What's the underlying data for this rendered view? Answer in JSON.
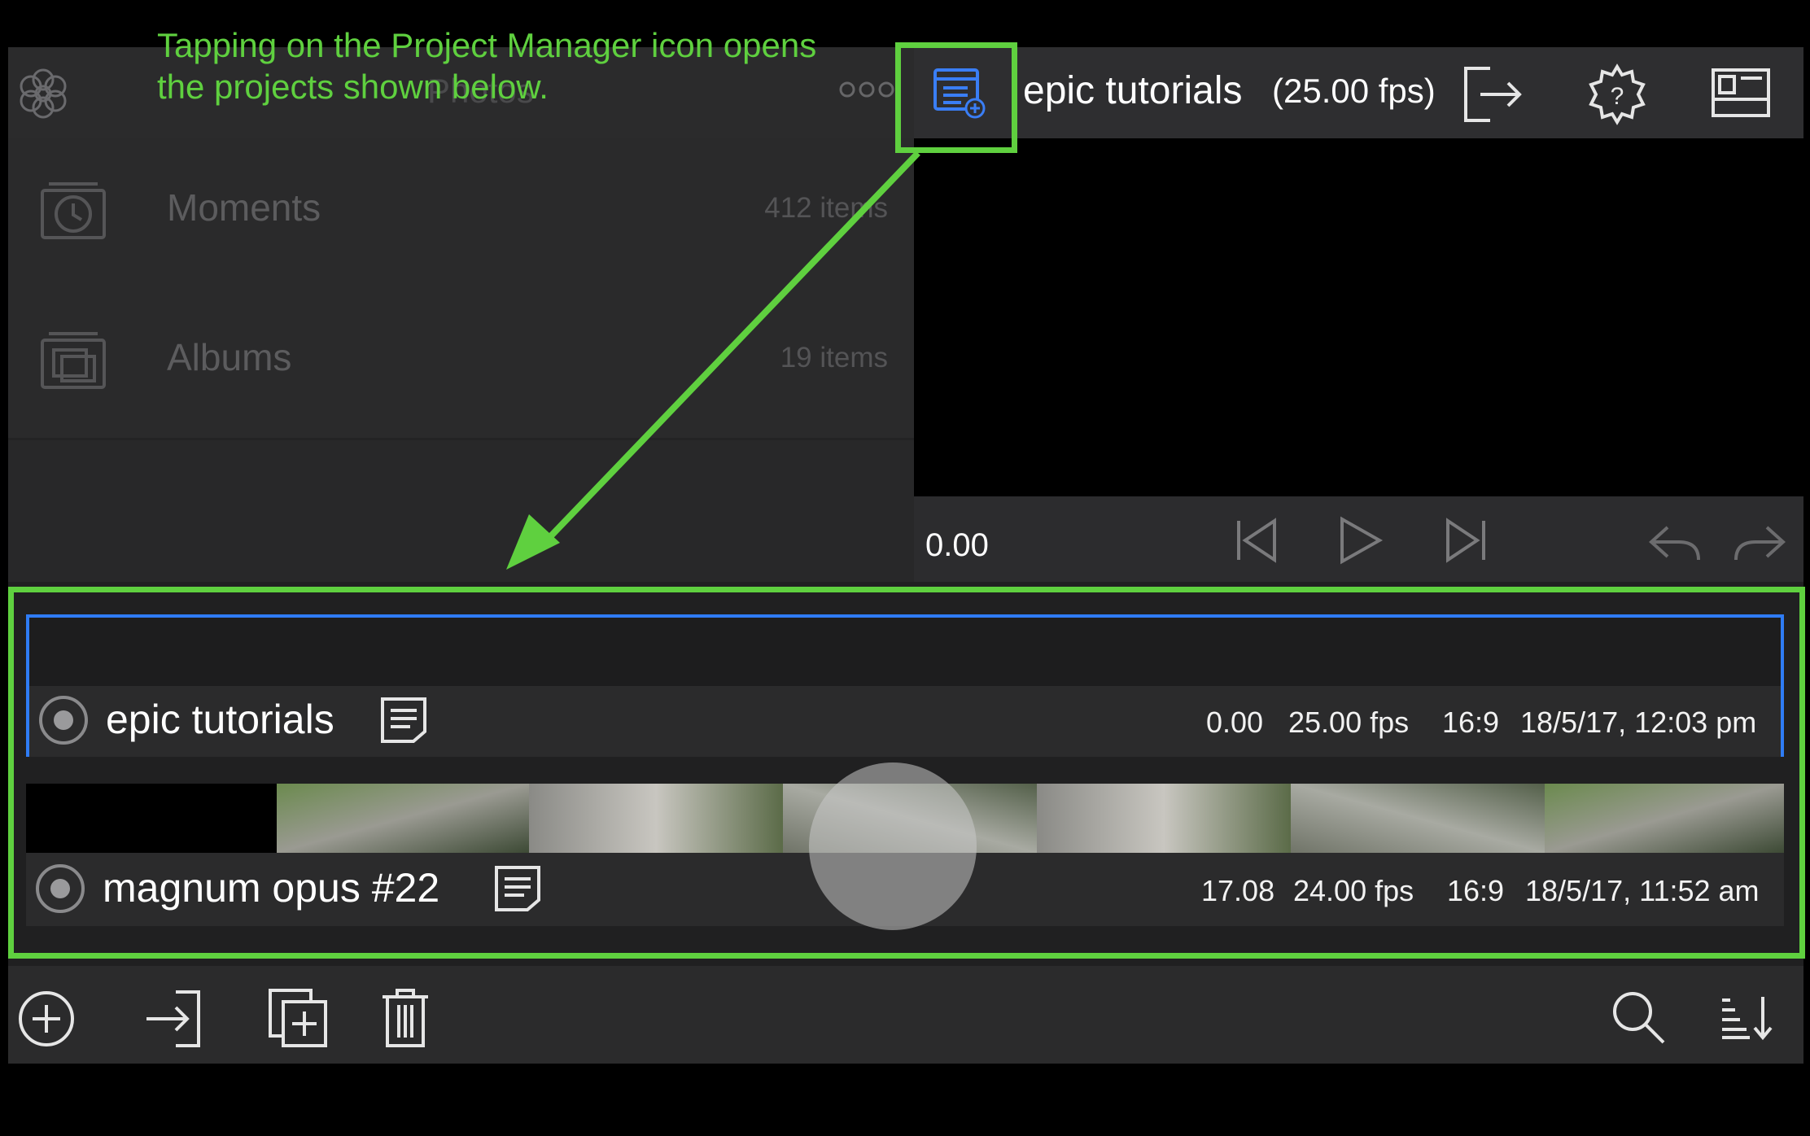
{
  "annotation": {
    "line1": "Tapping on the Project Manager icon opens",
    "line2": "the projects shown below."
  },
  "media_browser": {
    "header_title_faded": "Photos",
    "rows": [
      {
        "label": "Moments",
        "count": "412 items",
        "icon": "moments-clock-icon"
      },
      {
        "label": "Albums",
        "count": "19 items",
        "icon": "albums-icon"
      }
    ]
  },
  "top_bar": {
    "project_title": "epic tutorials",
    "fps": "(25.00 fps)"
  },
  "transport": {
    "timecode": "0.00"
  },
  "projects": [
    {
      "name": "epic tutorials",
      "duration": "0.00",
      "fps": "25.00 fps",
      "aspect": "16:9",
      "date": "18/5/17, 12:03 pm",
      "selected": true
    },
    {
      "name": "magnum opus #22",
      "duration": "17.08",
      "fps": "24.00 fps",
      "aspect": "16:9",
      "date": "18/5/17, 11:52 am",
      "selected": false
    }
  ],
  "colors": {
    "annotation_green": "#5fd03f",
    "selection_blue": "#2f7cf6",
    "panel_dark": "#2b2b2c"
  }
}
